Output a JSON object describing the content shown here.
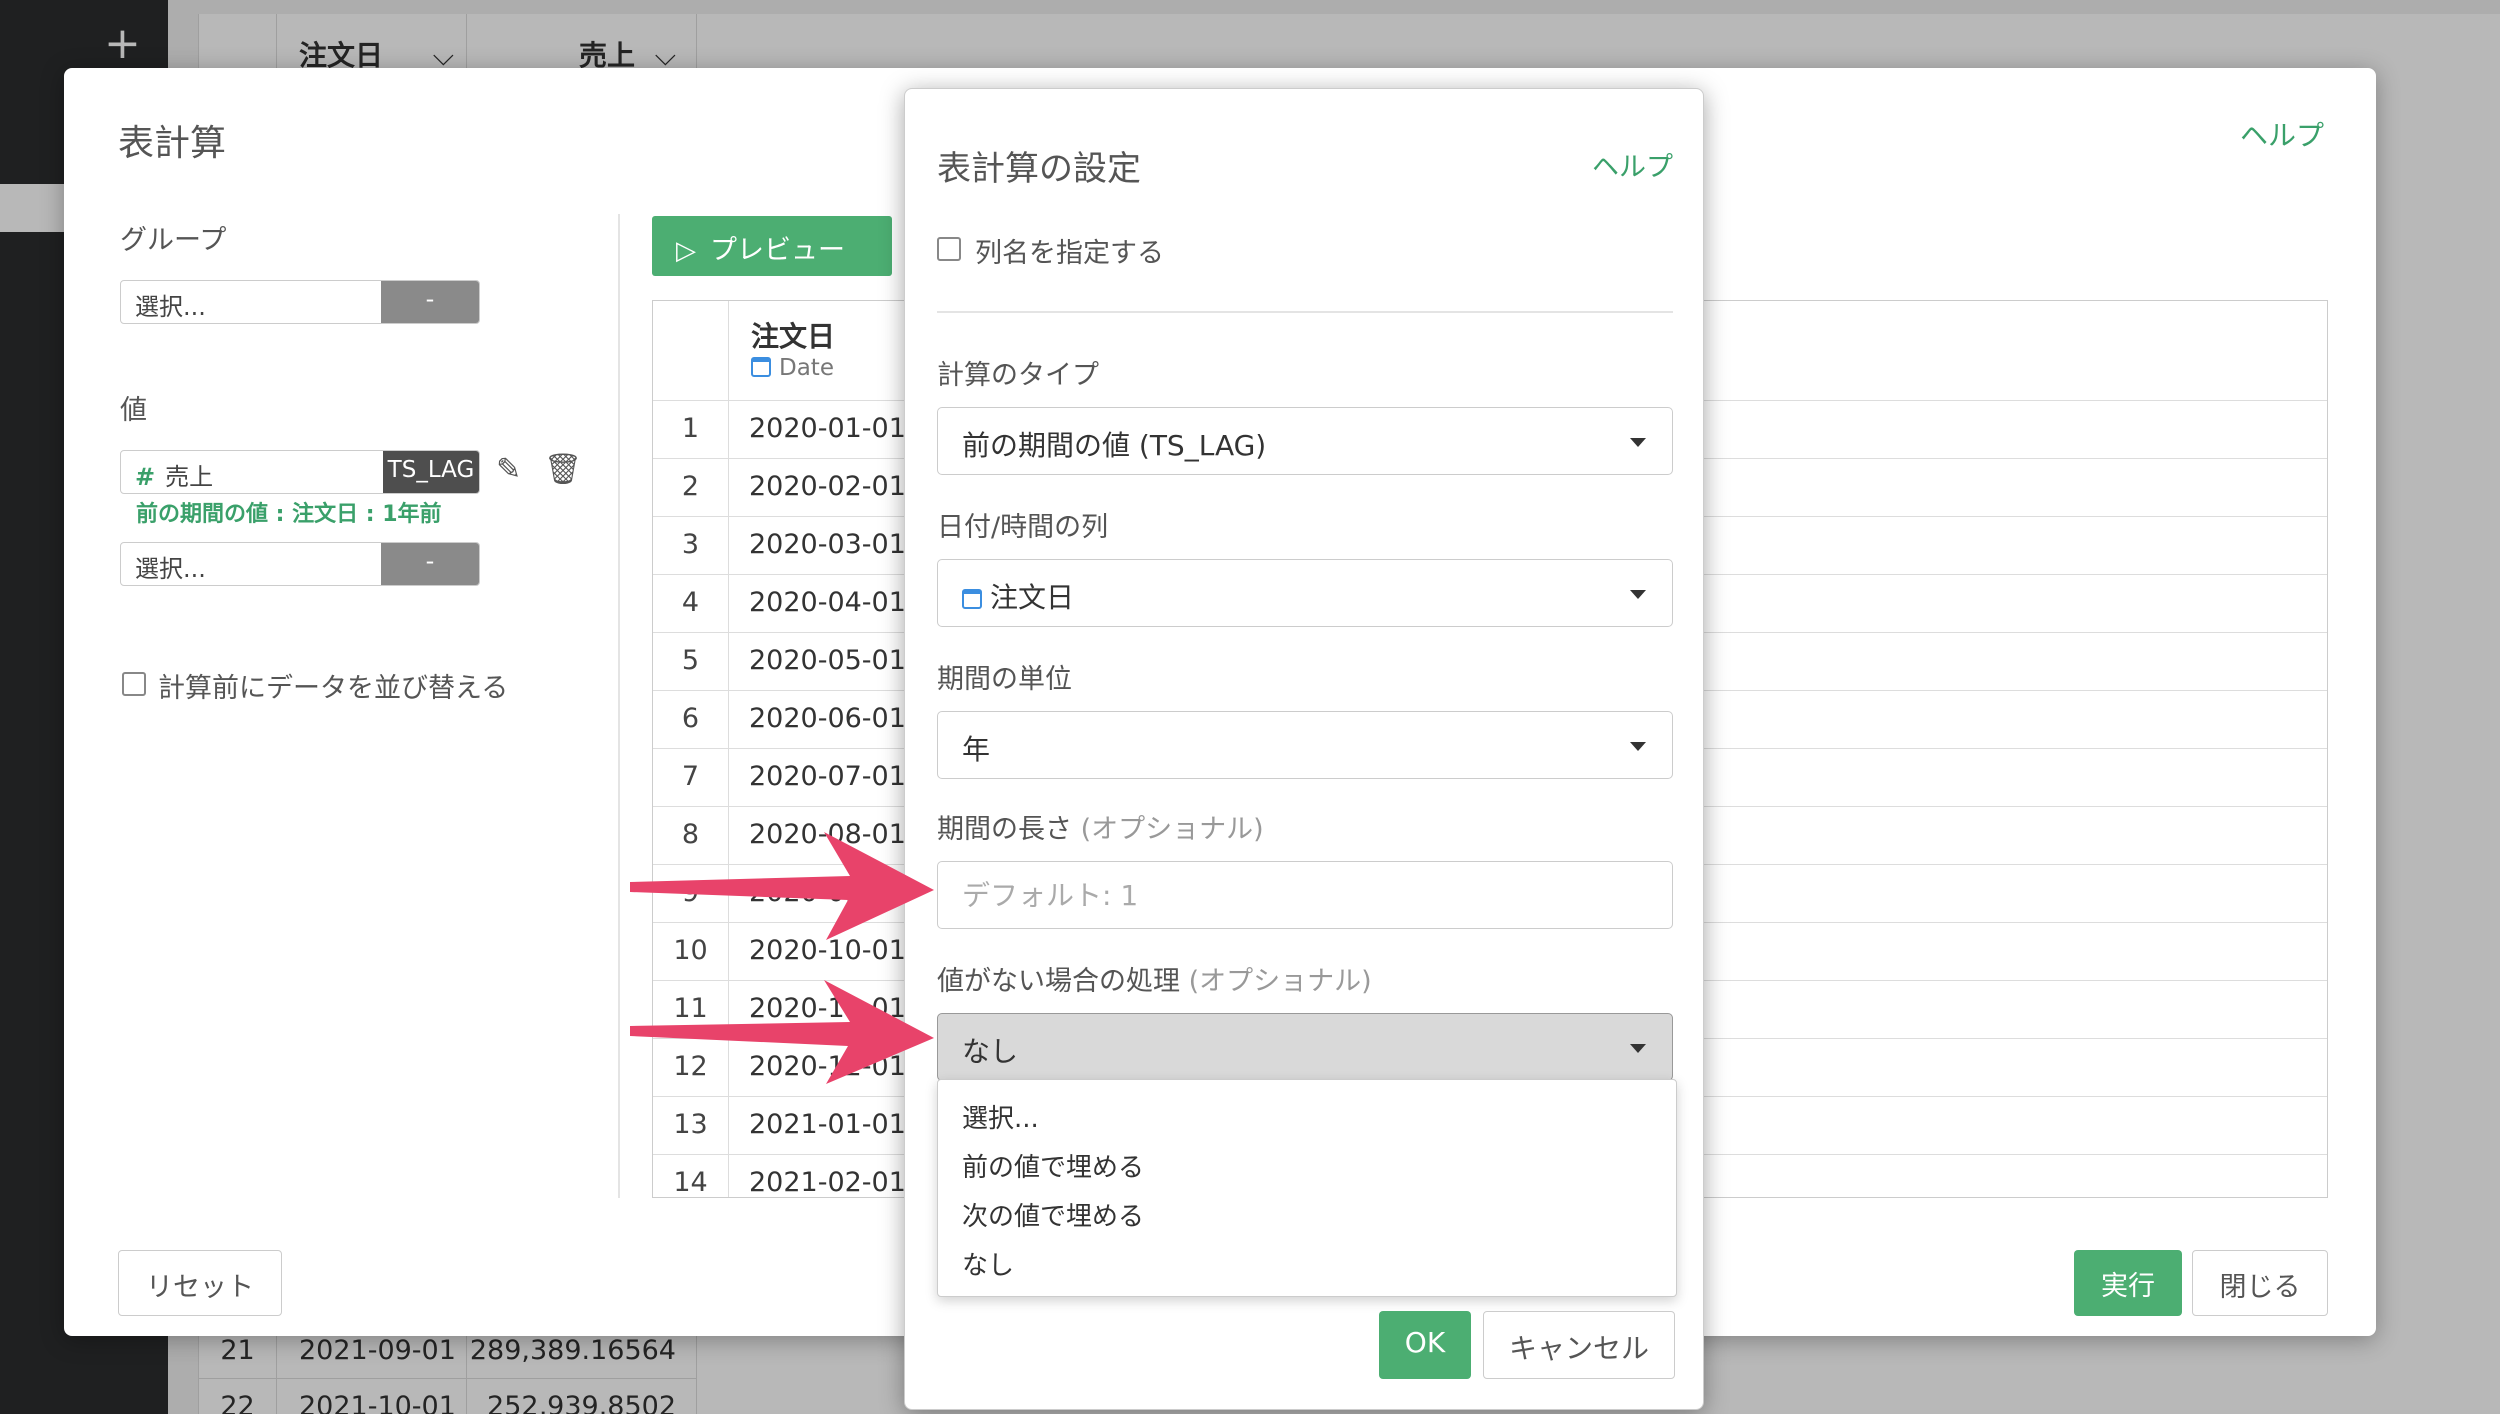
{
  "background": {
    "add_icon": "+",
    "header": {
      "col1": "注文日",
      "col2": "売上"
    },
    "rows": [
      {
        "num": "21",
        "date": "2021-09-01",
        "value": "289,389.16564"
      },
      {
        "num": "22",
        "date": "2021-10-01",
        "value": "252,939.8502"
      }
    ]
  },
  "dialog": {
    "title": "表計算",
    "help": "ヘルプ",
    "group_label": "グループ",
    "group_select": "選択...",
    "group_button": "-",
    "value_label": "値",
    "value_field": "売上",
    "value_func": "TS_LAG",
    "value_note": "前の期間の値 : 注文日 : 1年前",
    "value_select": "選択...",
    "value_button": "-",
    "sort_checkbox_label": "計算前にデータを並び替える",
    "preview_button": "プレビュー",
    "preview_table": {
      "column_name": "注文日",
      "column_type": "Date",
      "rows": [
        {
          "num": "1",
          "date": "2020-01-01"
        },
        {
          "num": "2",
          "date": "2020-02-01"
        },
        {
          "num": "3",
          "date": "2020-03-01"
        },
        {
          "num": "4",
          "date": "2020-04-01"
        },
        {
          "num": "5",
          "date": "2020-05-01"
        },
        {
          "num": "6",
          "date": "2020-06-01"
        },
        {
          "num": "7",
          "date": "2020-07-01"
        },
        {
          "num": "8",
          "date": "2020-08-01"
        },
        {
          "num": "9",
          "date": "2020-09-01"
        },
        {
          "num": "10",
          "date": "2020-10-01"
        },
        {
          "num": "11",
          "date": "2020-11-01"
        },
        {
          "num": "12",
          "date": "2020-12-01"
        },
        {
          "num": "13",
          "date": "2021-01-01"
        },
        {
          "num": "14",
          "date": "2021-02-01"
        }
      ]
    },
    "reset_button": "リセット",
    "run_button": "実行",
    "close_button": "閉じる"
  },
  "settings": {
    "title": "表計算の設定",
    "help": "ヘルプ",
    "column_name_checkbox": "列名を指定する",
    "calc_type_label": "計算のタイプ",
    "calc_type_value": "前の期間の値 (TS_LAG)",
    "date_column_label": "日付/時間の列",
    "date_column_value": "注文日",
    "period_unit_label": "期間の単位",
    "period_unit_value": "年",
    "period_length_label": "期間の長さ",
    "optional": "(オプショナル)",
    "period_length_placeholder": "デフォルト: 1",
    "missing_label": "値がない場合の処理",
    "missing_value": "なし",
    "missing_options": [
      "選択...",
      "前の値で埋める",
      "次の値で埋める",
      "なし"
    ],
    "ok_button": "OK",
    "cancel_button": "キャンセル"
  },
  "colors": {
    "accent_green": "#4cae72",
    "arrow_pink": "#e8436a",
    "date_icon_blue": "#3b8ee0"
  }
}
